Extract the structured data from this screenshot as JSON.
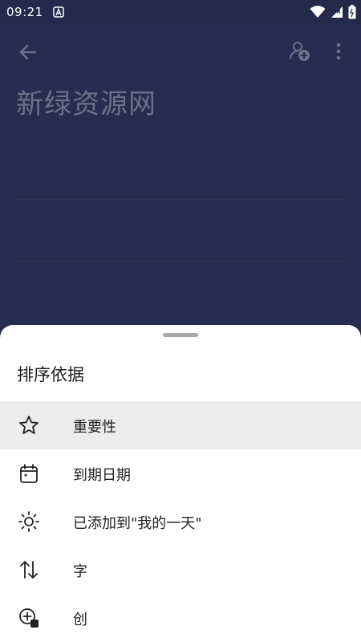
{
  "status_bar": {
    "time": "09:21",
    "notification_icon": "a-badge-icon",
    "system_icons": [
      "wifi-icon",
      "cellular-signal-icon",
      "battery-icon"
    ]
  },
  "background_app": {
    "list_title": "新绿资源网",
    "icons": [
      "back-arrow-icon",
      "share-list-icon",
      "more-vertical-icon"
    ]
  },
  "sort_sheet": {
    "heading": "排序依据",
    "options": [
      {
        "label": "重要性",
        "icon": "star-icon",
        "selected": true
      },
      {
        "label": "到期日期",
        "icon": "calendar-icon",
        "selected": false
      },
      {
        "label": "已添加到\"我的一天\"",
        "icon": "sun-icon",
        "selected": false
      },
      {
        "label": "字",
        "icon": "sort-arrows-icon",
        "selected": false
      },
      {
        "label": "创",
        "icon": "add-date-icon",
        "selected": false
      }
    ]
  },
  "colors": {
    "app_background": "#262d50",
    "sheet_background": "#ffffff",
    "selected_row": "#ececec"
  }
}
